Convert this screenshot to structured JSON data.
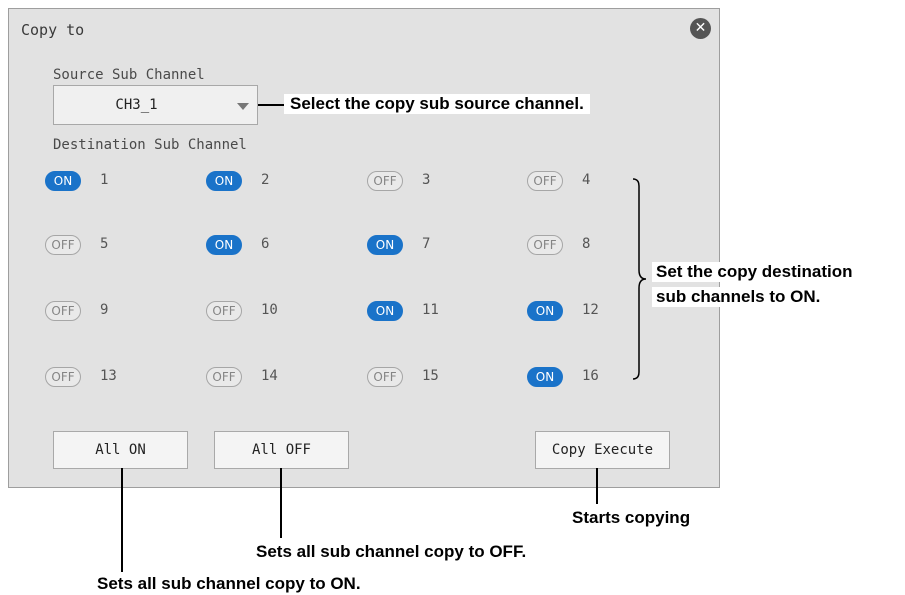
{
  "dialog": {
    "title": "Copy to",
    "close_icon": "close-circle-icon",
    "source_label": "Source Sub Channel",
    "source_value": "CH3_1",
    "destination_label": "Destination Sub Channel"
  },
  "channels": [
    {
      "num": "1",
      "state": "ON"
    },
    {
      "num": "2",
      "state": "ON"
    },
    {
      "num": "3",
      "state": "OFF"
    },
    {
      "num": "4",
      "state": "OFF"
    },
    {
      "num": "5",
      "state": "OFF"
    },
    {
      "num": "6",
      "state": "ON"
    },
    {
      "num": "7",
      "state": "ON"
    },
    {
      "num": "8",
      "state": "OFF"
    },
    {
      "num": "9",
      "state": "OFF"
    },
    {
      "num": "10",
      "state": "OFF"
    },
    {
      "num": "11",
      "state": "ON"
    },
    {
      "num": "12",
      "state": "ON"
    },
    {
      "num": "13",
      "state": "OFF"
    },
    {
      "num": "14",
      "state": "OFF"
    },
    {
      "num": "15",
      "state": "OFF"
    },
    {
      "num": "16",
      "state": "ON"
    }
  ],
  "buttons": {
    "all_on": "All ON",
    "all_off": "All OFF",
    "copy_execute": "Copy Execute"
  },
  "callouts": {
    "source": "Select the copy sub source channel.",
    "destination_line1": "Set the copy destination",
    "destination_line2": "sub channels to ON.",
    "copy_execute": "Starts copying",
    "all_off": "Sets all sub channel copy to OFF.",
    "all_on": "Sets all sub channel copy to ON."
  },
  "colors": {
    "on_toggle": "#1a73c9",
    "off_toggle": "#e9e9e9",
    "dialog_bg": "#e2e2e2"
  }
}
